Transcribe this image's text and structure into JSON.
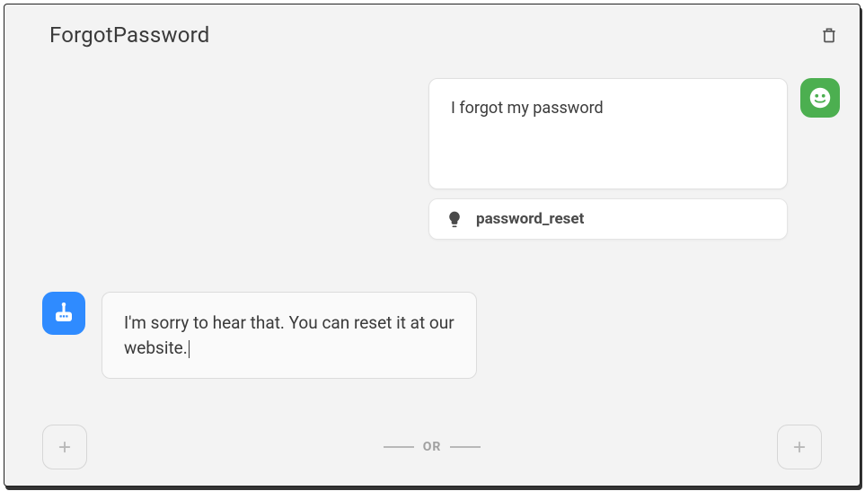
{
  "header": {
    "title": "ForgotPassword"
  },
  "user_message": {
    "text": "I forgot my password"
  },
  "intent": {
    "label": "password_reset"
  },
  "bot_message": {
    "text": "I'm sorry to hear that. You can reset it at our website."
  },
  "footer": {
    "or_label": "OR"
  }
}
